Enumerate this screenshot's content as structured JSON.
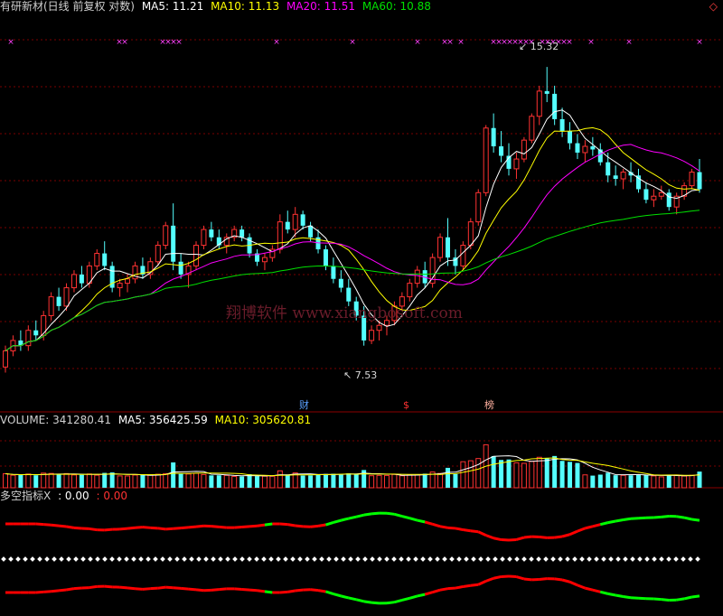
{
  "main_header": {
    "title": "有研新材(日线 前复权 对数)",
    "ma5": "MA5: 11.21",
    "ma10": "MA10: 11.13",
    "ma20": "MA20: 11.51",
    "ma60": "MA60: 10.88"
  },
  "volume_header": {
    "volume": "VOLUME: 341280.41",
    "ma5": "MA5: 356425.59",
    "ma10": "MA10: 305620.81"
  },
  "indicator_header": {
    "name": "多空指标X",
    "v1": ": 0.00",
    "v2": ": 0.00"
  },
  "annotations": {
    "high": "15.32",
    "low": "7.53"
  },
  "markers": {
    "cai": "财",
    "dollar": "$",
    "bang": "榜"
  },
  "watermark": "翔博软件 www.xiangbosoft.com",
  "colors": {
    "up": "#ff3232",
    "down": "#54ffff",
    "ma5": "#ffffff",
    "ma10": "#ffff00",
    "ma20": "#ff00ff",
    "ma60": "#00e000",
    "ind_bull": "#ff0000",
    "ind_bear": "#00ff00"
  },
  "chart_data": {
    "type": "candlestick",
    "price_scale": "log",
    "price_range": [
      6.8,
      16.2
    ],
    "ohlc": [
      [
        7.1,
        7.5,
        7.0,
        7.4
      ],
      [
        7.4,
        7.7,
        7.3,
        7.6
      ],
      [
        7.6,
        7.8,
        7.4,
        7.5
      ],
      [
        7.5,
        7.9,
        7.4,
        7.8
      ],
      [
        7.8,
        8.0,
        7.6,
        7.7
      ],
      [
        7.7,
        8.2,
        7.6,
        8.1
      ],
      [
        8.1,
        8.6,
        8.0,
        8.5
      ],
      [
        8.5,
        8.7,
        8.2,
        8.3
      ],
      [
        8.3,
        8.8,
        8.2,
        8.7
      ],
      [
        8.7,
        9.1,
        8.6,
        9.0
      ],
      [
        9.0,
        9.2,
        8.7,
        8.8
      ],
      [
        8.8,
        9.3,
        8.7,
        9.2
      ],
      [
        9.2,
        9.6,
        9.1,
        9.5
      ],
      [
        9.5,
        9.8,
        9.1,
        9.2
      ],
      [
        9.2,
        9.3,
        8.6,
        8.7
      ],
      [
        8.7,
        8.9,
        8.5,
        8.8
      ],
      [
        8.8,
        9.0,
        8.6,
        8.9
      ],
      [
        8.9,
        9.3,
        8.8,
        9.2
      ],
      [
        9.2,
        9.4,
        8.9,
        9.0
      ],
      [
        9.0,
        9.4,
        8.9,
        9.3
      ],
      [
        9.3,
        9.8,
        9.2,
        9.7
      ],
      [
        9.7,
        10.3,
        9.6,
        10.2
      ],
      [
        10.2,
        10.8,
        9.1,
        9.3
      ],
      [
        9.3,
        9.5,
        8.9,
        9.0
      ],
      [
        9.0,
        9.3,
        8.7,
        9.2
      ],
      [
        9.2,
        9.8,
        9.1,
        9.7
      ],
      [
        9.7,
        10.2,
        9.6,
        10.1
      ],
      [
        10.1,
        10.3,
        9.8,
        9.9
      ],
      [
        9.9,
        10.1,
        9.6,
        9.7
      ],
      [
        9.7,
        10.0,
        9.5,
        9.9
      ],
      [
        9.9,
        10.2,
        9.8,
        10.1
      ],
      [
        10.1,
        10.2,
        9.8,
        9.9
      ],
      [
        9.9,
        10.0,
        9.4,
        9.5
      ],
      [
        9.5,
        9.6,
        9.2,
        9.3
      ],
      [
        9.3,
        9.5,
        9.1,
        9.4
      ],
      [
        9.4,
        9.7,
        9.3,
        9.6
      ],
      [
        9.6,
        10.5,
        9.5,
        10.3
      ],
      [
        10.3,
        10.6,
        10.0,
        10.1
      ],
      [
        10.1,
        10.7,
        9.9,
        10.5
      ],
      [
        10.5,
        10.6,
        10.1,
        10.2
      ],
      [
        10.2,
        10.3,
        9.8,
        9.9
      ],
      [
        9.9,
        10.1,
        9.5,
        9.6
      ],
      [
        9.6,
        9.7,
        9.1,
        9.2
      ],
      [
        9.2,
        9.4,
        8.8,
        8.9
      ],
      [
        8.9,
        9.1,
        8.6,
        8.7
      ],
      [
        8.7,
        8.9,
        8.3,
        8.4
      ],
      [
        8.4,
        8.5,
        8.0,
        8.1
      ],
      [
        8.1,
        8.3,
        7.5,
        7.6
      ],
      [
        7.6,
        7.9,
        7.53,
        7.8
      ],
      [
        7.8,
        8.0,
        7.6,
        7.9
      ],
      [
        7.9,
        8.1,
        7.7,
        8.0
      ],
      [
        8.0,
        8.4,
        7.9,
        8.3
      ],
      [
        8.3,
        8.6,
        8.2,
        8.5
      ],
      [
        8.5,
        8.9,
        8.4,
        8.8
      ],
      [
        8.8,
        9.2,
        8.7,
        9.1
      ],
      [
        9.1,
        9.3,
        8.7,
        8.8
      ],
      [
        8.8,
        9.5,
        8.7,
        9.4
      ],
      [
        9.4,
        10.0,
        9.3,
        9.9
      ],
      [
        9.9,
        10.4,
        9.2,
        9.4
      ],
      [
        9.4,
        9.6,
        9.0,
        9.2
      ],
      [
        9.2,
        9.8,
        9.1,
        9.7
      ],
      [
        9.7,
        10.4,
        9.6,
        10.3
      ],
      [
        10.3,
        11.2,
        10.2,
        11.1
      ],
      [
        11.1,
        13.2,
        11.0,
        13.1
      ],
      [
        13.1,
        13.6,
        12.3,
        12.5
      ],
      [
        12.5,
        13.0,
        12.0,
        12.2
      ],
      [
        12.2,
        12.6,
        11.6,
        11.8
      ],
      [
        11.8,
        12.3,
        11.5,
        12.1
      ],
      [
        12.1,
        12.8,
        12.0,
        12.7
      ],
      [
        12.7,
        13.6,
        12.6,
        13.5
      ],
      [
        13.5,
        14.6,
        13.2,
        14.4
      ],
      [
        14.4,
        15.32,
        14.0,
        14.3
      ],
      [
        14.3,
        14.6,
        13.2,
        13.4
      ],
      [
        13.4,
        13.8,
        12.8,
        13.0
      ],
      [
        13.0,
        13.3,
        12.4,
        12.6
      ],
      [
        12.6,
        12.9,
        12.1,
        12.3
      ],
      [
        12.3,
        12.7,
        12.0,
        12.5
      ],
      [
        12.5,
        12.8,
        12.2,
        12.4
      ],
      [
        12.4,
        12.6,
        11.9,
        12.0
      ],
      [
        12.0,
        12.3,
        11.4,
        11.6
      ],
      [
        11.6,
        11.9,
        11.3,
        11.5
      ],
      [
        11.5,
        11.8,
        11.2,
        11.7
      ],
      [
        11.7,
        12.0,
        11.4,
        11.6
      ],
      [
        11.6,
        11.8,
        11.1,
        11.2
      ],
      [
        11.2,
        11.4,
        10.8,
        10.9
      ],
      [
        10.9,
        11.2,
        10.7,
        11.0
      ],
      [
        11.0,
        11.3,
        10.9,
        11.1
      ],
      [
        11.1,
        11.2,
        10.6,
        10.7
      ],
      [
        10.7,
        11.1,
        10.5,
        11.0
      ],
      [
        11.0,
        11.4,
        10.9,
        11.3
      ],
      [
        11.3,
        11.8,
        11.2,
        11.7
      ],
      [
        11.7,
        12.1,
        11.1,
        11.2
      ]
    ],
    "volume_range": [
      0,
      750000
    ]
  }
}
